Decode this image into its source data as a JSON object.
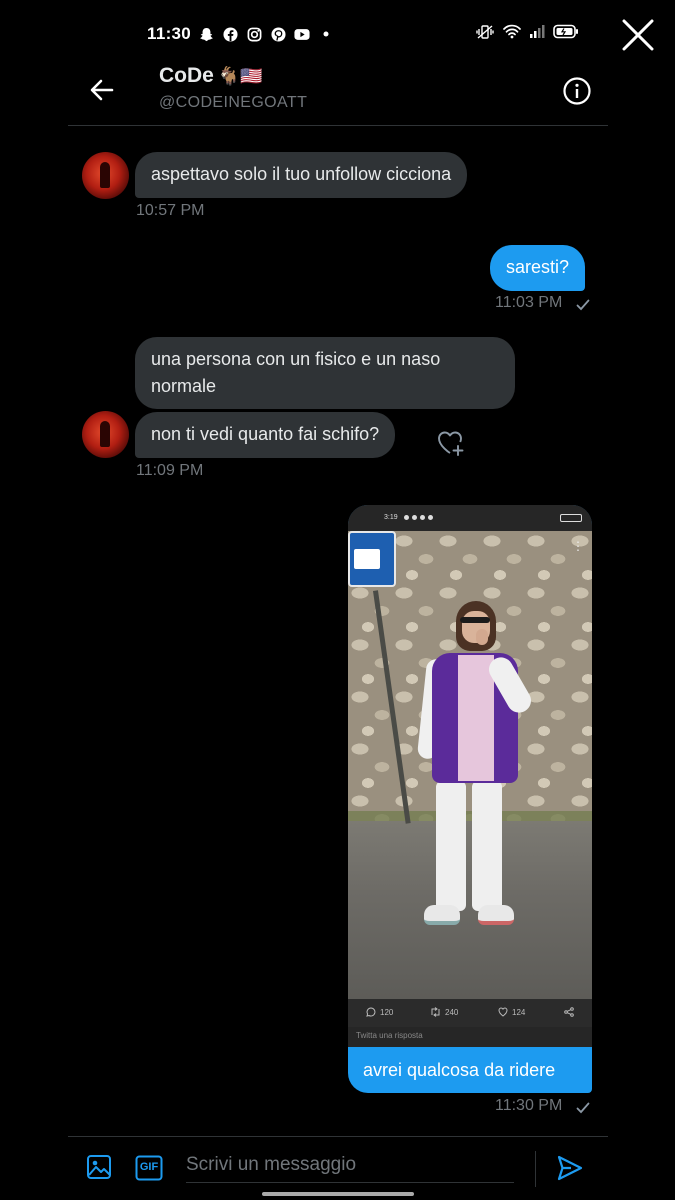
{
  "status_bar": {
    "time": "11:30",
    "app_icons": [
      "snapchat-icon",
      "facebook-icon",
      "instagram-icon",
      "pinterest-icon",
      "youtube-icon",
      "dot-icon"
    ],
    "right_icons": [
      "vibrate-icon",
      "wifi-icon",
      "signal-icon",
      "battery-icon"
    ]
  },
  "header": {
    "name": "CoDe",
    "name_emojis": "🐐🇺🇸",
    "handle": "@CODEINEGOATT"
  },
  "messages": [
    {
      "direction": "in",
      "text": "aspettavo solo il tuo unfollow cicciona",
      "timestamp": "10:57 PM"
    },
    {
      "direction": "out",
      "text": "saresti?",
      "timestamp": "11:03 PM",
      "read": true
    },
    {
      "direction": "in",
      "text": "una persona con un fisico e un naso normale"
    },
    {
      "direction": "in",
      "text": "non ti vedi quanto fai schifo?",
      "timestamp": "11:09 PM"
    },
    {
      "direction": "out",
      "type": "image",
      "text": "avrei qualcosa da ridere",
      "timestamp": "11:30 PM",
      "read": true
    }
  ],
  "shared_screenshot": {
    "time": "3:19",
    "replies": "120",
    "retweets": "240",
    "likes": "124",
    "reply_placeholder": "Twitta una risposta"
  },
  "composer": {
    "placeholder": "Scrivi un messaggio",
    "gif_label": "GIF"
  },
  "colors": {
    "background": "#000000",
    "incoming_bubble": "#2f3336",
    "outgoing_bubble": "#1d9bf0",
    "muted_text": "#71767b",
    "accent": "#1d9bf0"
  }
}
